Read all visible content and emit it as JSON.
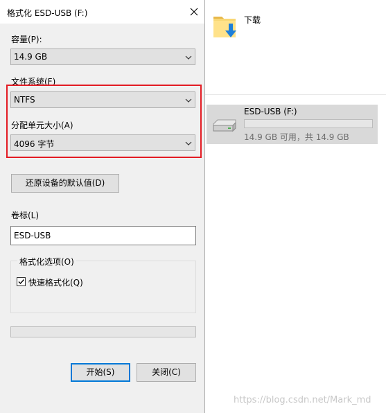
{
  "dialog": {
    "title": "格式化 ESD-USB (F:)",
    "capacity": {
      "label": "容量(P):",
      "value": "14.9 GB"
    },
    "file_system": {
      "label": "文件系统(F)",
      "value": "NTFS"
    },
    "allocation_unit": {
      "label": "分配单元大小(A)",
      "value": "4096 字节"
    },
    "restore_defaults_label": "还原设备的默认值(D)",
    "volume_label": {
      "label": "卷标(L)",
      "value": "ESD-USB"
    },
    "format_options": {
      "legend": "格式化选项(O)",
      "quick_format": {
        "label": "快速格式化(Q)",
        "checked": true
      }
    },
    "progress": 0,
    "start_label": "开始(S)",
    "close_label": "关闭(C)"
  },
  "explorer": {
    "folder_label": "下载",
    "drive": {
      "name": "ESD-USB (F:)",
      "space": "14.9 GB 可用，共 14.9 GB",
      "used_fraction": 0
    }
  },
  "watermark": "https://blog.csdn.net/Mark_md",
  "colors": {
    "dialog_bg": "#f0f0f0",
    "highlight": "#e31b23",
    "default_button_border": "#0078d7",
    "selected_tile": "#d9d9d9"
  }
}
